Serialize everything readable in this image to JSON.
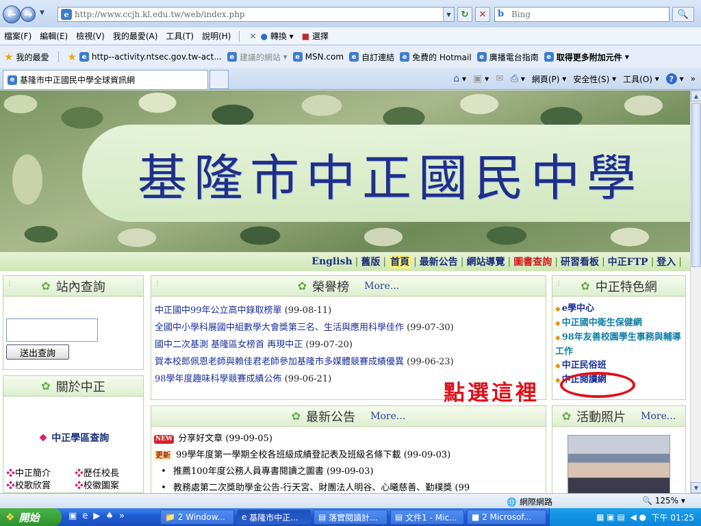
{
  "browser": {
    "url": "http://www.ccjh.kl.edu.tw/web/index.php",
    "search_placeholder": "Bing",
    "menu": [
      "檔案(F)",
      "編輯(E)",
      "檢視(V)",
      "我的最愛(A)",
      "工具(T)",
      "說明(H)"
    ],
    "menu_tools": [
      "轉換",
      "選擇"
    ],
    "favorites_label": "我的最愛",
    "favorites": [
      "http--activity.ntsec.gov.tw-act...",
      "建議的網站",
      "MSN.com",
      "自訂連結",
      "免費的 Hotmail",
      "廣播電台指南",
      "取得更多附加元件"
    ],
    "tab_title": "基隆市中正國民中學全球資訊網",
    "commands": [
      "網頁(P)",
      "安全性(S)",
      "工具(O)"
    ]
  },
  "page": {
    "banner_title": "基隆市中正國民中學",
    "nav": [
      "English",
      "舊版",
      "首頁",
      "最新公告",
      "網站導覽",
      "圖書查詢",
      "研習看板",
      "中正FTP",
      "登入"
    ],
    "search_panel": {
      "title": "站內查詢",
      "button": "送出查詢"
    },
    "honor_panel": {
      "title": "榮譽榜",
      "more": "More...",
      "items": [
        {
          "title": "中正國中99年公立高中錄取榜單",
          "date": "(99-08-11)"
        },
        {
          "title": "全國中小學科展國中組數學大會獎第三名、生活與應用科學佳作",
          "date": "(99-07-30)"
        },
        {
          "title": "國中二次基測 基隆區女榜首 再現中正",
          "date": "(99-07-20)"
        },
        {
          "title": "賀本校郎佩恩老師與賴佳君老師參加基隆市多媒體競賽成績優異",
          "date": "(99-06-23)"
        },
        {
          "title": "98學年度趣味科學競賽成績公佈",
          "date": "(99-06-21)"
        }
      ]
    },
    "feature_panel": {
      "title": "中正特色網",
      "items": [
        "e學中心",
        "中正國中衛生保健網",
        "98年友善校園學生事務與輔導工作",
        "中正民俗班",
        "中正閱讀網"
      ]
    },
    "about_panel": {
      "title": "關於中正",
      "zone_link": "中正學區查詢",
      "links": [
        "中正簡介",
        "歷任校長",
        "校歌欣賞",
        "校徽圖案"
      ]
    },
    "news_panel": {
      "title": "最新公告",
      "more": "More...",
      "new_badge": "NEW",
      "update_badge": "更新",
      "items": [
        {
          "text": "分享好文章",
          "date": "(99-09-05)"
        },
        {
          "text": "99學年度第一學期全校各班級成績登記表及班級名條下載",
          "date": "(99-09-03)"
        },
        {
          "text": "推薦100年度公務人員專書閱讀之圖書",
          "date": "(99-09-03)"
        },
        {
          "text": "教務處第二次獎助學金公告-行天宮、財團法人明谷、心曦慈善、勤樸獎",
          "date": "(99"
        }
      ]
    },
    "photos_panel": {
      "title": "活動照片",
      "more": "More..."
    }
  },
  "annotation": {
    "text": "點選這裡",
    "color": "#e0101a"
  },
  "status": {
    "zone": "網際網路",
    "zoom": "125%"
  },
  "taskbar": {
    "start": "開始",
    "tasks": [
      "2 Window...",
      "基隆市中正...",
      "落實閱讀計...",
      "文件1 - Mic...",
      "2 Microsof..."
    ],
    "clock": "下午 01:25"
  }
}
